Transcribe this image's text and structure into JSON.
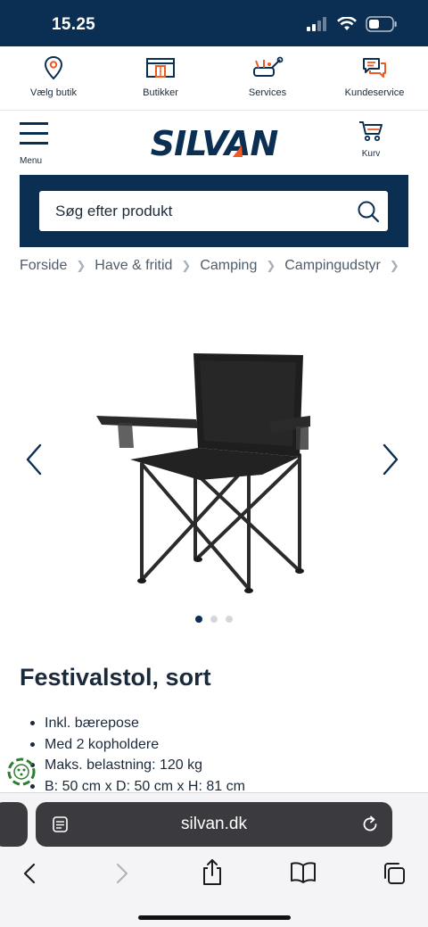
{
  "status": {
    "time": "15.25"
  },
  "utility_nav": [
    {
      "label": "Vælg butik",
      "icon": "location-pin-icon"
    },
    {
      "label": "Butikker",
      "icon": "store-icon"
    },
    {
      "label": "Services",
      "icon": "tools-icon"
    },
    {
      "label": "Kundeservice",
      "icon": "chat-bubbles-icon"
    }
  ],
  "header": {
    "menu_label": "Menu",
    "logo_text": "SILVAN",
    "cart_label": "Kurv"
  },
  "search": {
    "placeholder": "Søg efter produkt"
  },
  "breadcrumb": [
    "Forside",
    "Have & fritid",
    "Camping",
    "Campingudstyr"
  ],
  "gallery": {
    "image_count": 3,
    "active_index": 0
  },
  "product": {
    "title": "Festivalstol, sort",
    "features": [
      "Inkl. bærepose",
      "Med 2 kopholdere",
      "Maks. belastning: 120 kg",
      "B: 50 cm x D: 50 cm x H: 81 cm"
    ]
  },
  "browser": {
    "url": "silvan.dk"
  },
  "colors": {
    "brand_navy": "#0b2f52",
    "accent_orange": "#f05a22",
    "text": "#1b2a3a"
  }
}
